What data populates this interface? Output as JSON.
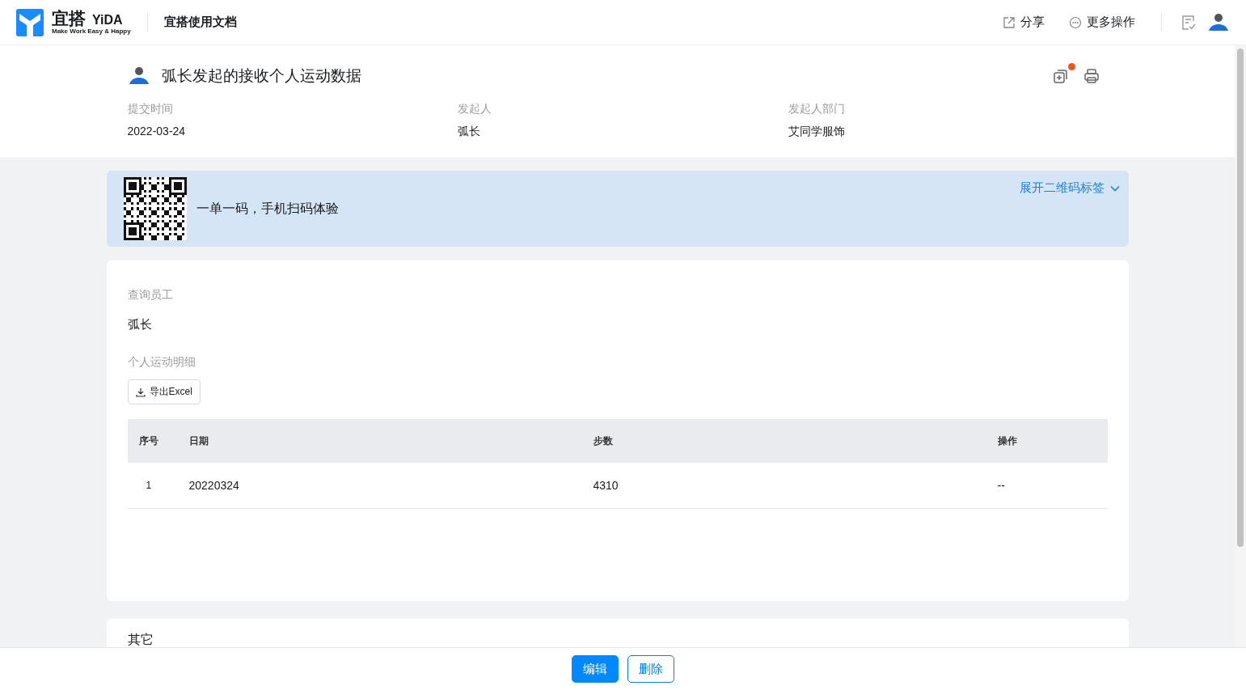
{
  "header": {
    "logo_cn": "宜搭",
    "logo_en": "YiDA",
    "logo_tagline": "Make Work Easy & Happy",
    "doc_link": "宜搭使用文档",
    "actions": [
      {
        "kind": "share",
        "label": "分享"
      },
      {
        "kind": "more",
        "label": "更多操作"
      }
    ]
  },
  "record": {
    "title": "弧长发起的接收个人运动数据",
    "has_notification": true,
    "meta": [
      {
        "label": "提交时间",
        "value": "2022-03-24"
      },
      {
        "label": "发起人",
        "value": "弧长"
      },
      {
        "label": "发起人部门",
        "value": "艾同学服饰"
      }
    ]
  },
  "qr_banner": {
    "text": "一单一码，手机扫码体验",
    "expand_link": "展开二维码标签"
  },
  "form": {
    "fields": [
      {
        "label": "查询员工",
        "value": "弧长"
      }
    ],
    "detail": {
      "label": "个人运动明细",
      "export_button": "导出Excel",
      "table": {
        "columns": [
          "序号",
          "日期",
          "步数",
          "操作"
        ],
        "rows": [
          [
            "1",
            "20220324",
            "4310",
            "--"
          ]
        ]
      }
    }
  },
  "next_section": {
    "title": "其它"
  },
  "footer": {
    "buttons": [
      {
        "label": "编辑",
        "kind": "primary"
      },
      {
        "label": "删除",
        "kind": "secondary"
      }
    ]
  }
}
